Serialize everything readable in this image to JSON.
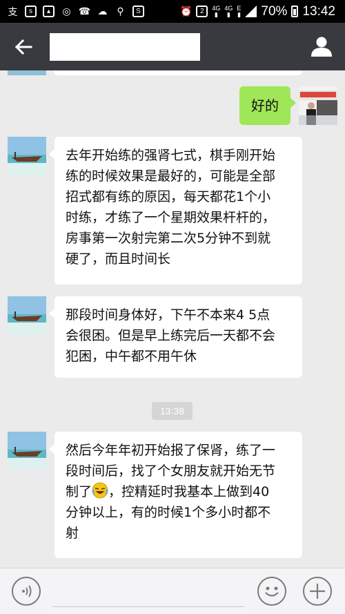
{
  "status_bar": {
    "battery": "70%",
    "time": "13:42",
    "network_1": "4G",
    "network_2": "4G",
    "network_3": "E",
    "sim_badge": "2",
    "icons": [
      "alipay-icon",
      "wechat-s-icon",
      "gallery-icon",
      "weibo-icon",
      "missed-call-icon",
      "weather-icon",
      "run-icon",
      "s-icon",
      "alarm-icon",
      "sim2-icon",
      "signal-icon",
      "battery-icon"
    ]
  },
  "header": {
    "back_icon": "arrow-left-icon",
    "title": "",
    "profile_icon": "person-icon"
  },
  "messages": [
    {
      "side": "right",
      "text": "好的"
    },
    {
      "side": "left",
      "lines": [
        "去年开始练的强肾七式，棋手刚开始",
        "练的时候效果是最好的，可能是全部",
        "招式都有练的原因，每天都花1个小",
        "时练，才练了一个星期效果杆杆的，",
        "房事第一次射完第二次5分钟不到就",
        "硬了，而且时间长"
      ]
    },
    {
      "side": "left",
      "lines": [
        "那段时间身体好，下午不本来4 5点",
        "会很困。但是早上练完后一天都不会",
        "犯困，中午都不用午休"
      ]
    },
    {
      "side": "left",
      "line1": "然后今年年初开始报了保肾，练了一",
      "line2": "段时间后，找了个女朋友就开始无节",
      "line3_before": "制了",
      "line3_after": "，控精延时我基本上做到40",
      "line4": "分钟以上，有的时候1个多小时都不",
      "line5": "射"
    }
  ],
  "timestamp": "13:38",
  "bottom_bar": {
    "voice_icon": "voice-icon",
    "emoji_icon": "smiley-icon",
    "plus_icon": "plus-icon"
  },
  "colors": {
    "header_bg": "#393a3f",
    "chat_bg": "#ebebeb",
    "outgoing_bubble": "#9fe658"
  }
}
